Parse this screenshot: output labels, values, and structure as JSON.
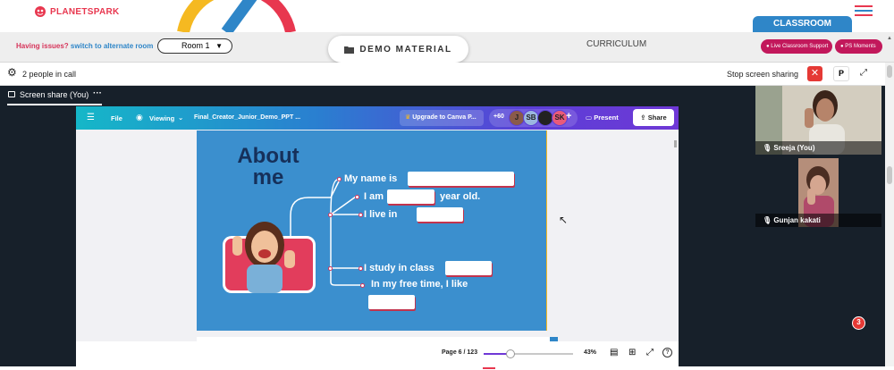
{
  "brand": {
    "name": "PLANETSPARK",
    "accent": "#e8374f"
  },
  "top": {
    "classroom_label": "CLASSROOM",
    "menu_icon": "hamburger-icon"
  },
  "bar2": {
    "issue_text": "Having issues?",
    "switch_link": "switch to alternate room",
    "room_selected": "Room 1",
    "demo_material": "DEMO MATERIAL",
    "curriculum": "CURRICULUM",
    "live_support": "Live Classroom Support",
    "ps_moments": "PS Moments"
  },
  "bar3": {
    "people": "2 people in call",
    "stop_share": "Stop screen sharing",
    "p_button": "P"
  },
  "tab": {
    "label": "Screen share (You)",
    "more": "···"
  },
  "canva": {
    "file": "File",
    "viewing": "Viewing",
    "doc_title": "Final_Creator_Junior_Demo_PPT ...",
    "upgrade": "Upgrade to Canva P...",
    "count": "+60",
    "avatars": [
      {
        "initials": "J",
        "color": "#8a5a4a"
      },
      {
        "initials": "SB",
        "color": "#9bb7e0"
      },
      {
        "initials": "",
        "color": "#222"
      },
      {
        "initials": "SK",
        "color": "#e85a7a"
      }
    ],
    "present": "Present",
    "share": "Share"
  },
  "slide": {
    "title1": "About",
    "title2": "me",
    "lines": [
      "My name is",
      "I am",
      "year old.",
      "I live in",
      "I study in class",
      "In my free time, I like"
    ]
  },
  "viewer_bottom": {
    "page": "Page 6 / 123",
    "zoom": "43%",
    "zoom_fraction": 0.3,
    "help": "?"
  },
  "participants": [
    {
      "name": "Sreeja (You)"
    },
    {
      "name": "Gunjan kakati"
    }
  ],
  "badge": "3"
}
